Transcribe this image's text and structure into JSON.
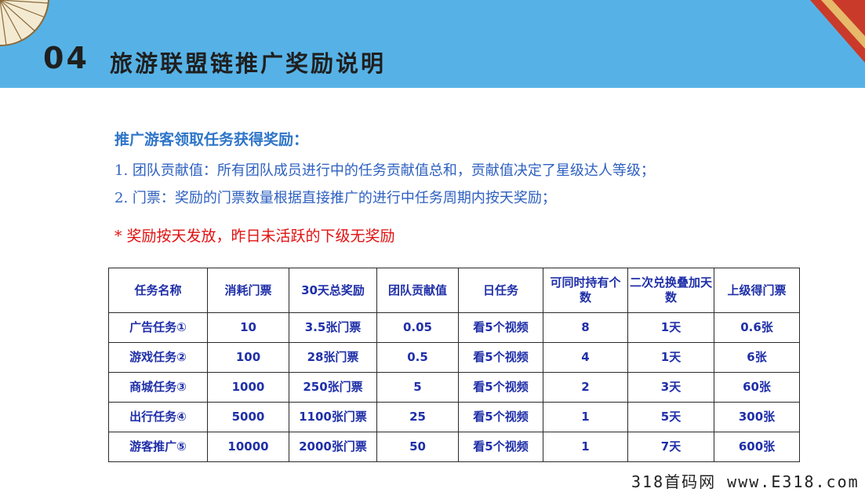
{
  "header": {
    "number": "04",
    "title": "旅游联盟链推广奖励说明"
  },
  "section": {
    "subhead": "推广游客领取任务获得奖励：",
    "items": [
      "1. 团队贡献值：所有团队成员进行中的任务贡献值总和，贡献值决定了星级达人等级；",
      "2. 门票：奖励的门票数量根据直接推广的进行中任务周期内按天奖励；"
    ],
    "note": "* 奖励按天发放，昨日未活跃的下级无奖励"
  },
  "table": {
    "headers": [
      "任务名称",
      "消耗门票",
      "30天总奖励",
      "团队贡献值",
      "日任务",
      "可同时持有个数",
      "二次兑换叠加天数",
      "上级得门票"
    ],
    "rows": [
      [
        "广告任务①",
        "10",
        "3.5张门票",
        "0.05",
        "看5个视频",
        "8",
        "1天",
        "0.6张"
      ],
      [
        "游戏任务②",
        "100",
        "28张门票",
        "0.5",
        "看5个视频",
        "4",
        "1天",
        "6张"
      ],
      [
        "商城任务③",
        "1000",
        "250张门票",
        "5",
        "看5个视频",
        "2",
        "3天",
        "60张"
      ],
      [
        "出行任务④",
        "5000",
        "1100张门票",
        "25",
        "看5个视频",
        "1",
        "5天",
        "300张"
      ],
      [
        "游客推广⑤",
        "10000",
        "2000张门票",
        "50",
        "看5个视频",
        "1",
        "7天",
        "600张"
      ]
    ]
  },
  "watermark": "318首码网 www.E318.com",
  "colors": {
    "header_bg": "#56b2e6",
    "subhead": "#2e75c8",
    "body_text": "#2e60c0",
    "note": "#e01010",
    "table_text": "#1f2fa8"
  }
}
